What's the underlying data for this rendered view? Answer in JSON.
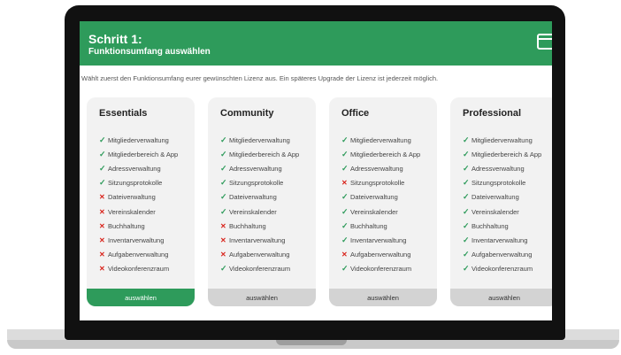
{
  "header": {
    "step": "Schritt 1:",
    "subtitle": "Funktionsumfang auswählen"
  },
  "intro": "Wählt zuerst den Funktionsumfang eurer gewünschten Lizenz aus. Ein späteres Upgrade der Lizenz ist jederzeit möglich.",
  "colors": {
    "brand_green": "#2e9b5b",
    "cross_red": "#d9251d",
    "card_bg": "#f2f2f2"
  },
  "cards": [
    {
      "title": "Essentials",
      "button": "auswählen",
      "primary": true,
      "features": [
        {
          "label": "Mitgliederverwaltung",
          "included": true
        },
        {
          "label": "Mitgliederbereich & App",
          "included": true
        },
        {
          "label": "Adressverwaltung",
          "included": true
        },
        {
          "label": "Sitzungsprotokolle",
          "included": true
        },
        {
          "label": "Dateiverwaltung",
          "included": false
        },
        {
          "label": "Vereinskalender",
          "included": false
        },
        {
          "label": "Buchhaltung",
          "included": false
        },
        {
          "label": "Inventarverwaltung",
          "included": false
        },
        {
          "label": "Aufgabenverwaltung",
          "included": false
        },
        {
          "label": "Videokonferenzraum",
          "included": false
        }
      ]
    },
    {
      "title": "Community",
      "button": "auswählen",
      "primary": false,
      "features": [
        {
          "label": "Mitgliederverwaltung",
          "included": true
        },
        {
          "label": "Mitgliederbereich & App",
          "included": true
        },
        {
          "label": "Adressverwaltung",
          "included": true
        },
        {
          "label": "Sitzungsprotokolle",
          "included": true
        },
        {
          "label": "Dateiverwaltung",
          "included": true
        },
        {
          "label": "Vereinskalender",
          "included": true
        },
        {
          "label": "Buchhaltung",
          "included": false
        },
        {
          "label": "Inventarverwaltung",
          "included": false
        },
        {
          "label": "Aufgabenverwaltung",
          "included": false
        },
        {
          "label": "Videokonferenzraum",
          "included": true
        }
      ]
    },
    {
      "title": "Office",
      "button": "auswählen",
      "primary": false,
      "features": [
        {
          "label": "Mitgliederverwaltung",
          "included": true
        },
        {
          "label": "Mitgliederbereich & App",
          "included": true
        },
        {
          "label": "Adressverwaltung",
          "included": true
        },
        {
          "label": "Sitzungsprotokolle",
          "included": false
        },
        {
          "label": "Dateiverwaltung",
          "included": true
        },
        {
          "label": "Vereinskalender",
          "included": true
        },
        {
          "label": "Buchhaltung",
          "included": true
        },
        {
          "label": "Inventarverwaltung",
          "included": true
        },
        {
          "label": "Aufgabenverwaltung",
          "included": false
        },
        {
          "label": "Videokonferenzraum",
          "included": true
        }
      ]
    },
    {
      "title": "Professional",
      "button": "auswählen",
      "primary": false,
      "features": [
        {
          "label": "Mitgliederverwaltung",
          "included": true
        },
        {
          "label": "Mitgliederbereich & App",
          "included": true
        },
        {
          "label": "Adressverwaltung",
          "included": true
        },
        {
          "label": "Sitzungsprotokolle",
          "included": true
        },
        {
          "label": "Dateiverwaltung",
          "included": true
        },
        {
          "label": "Vereinskalender",
          "included": true
        },
        {
          "label": "Buchhaltung",
          "included": true
        },
        {
          "label": "Inventarverwaltung",
          "included": true
        },
        {
          "label": "Aufgabenverwaltung",
          "included": true
        },
        {
          "label": "Videokonferenzraum",
          "included": true
        }
      ]
    }
  ]
}
